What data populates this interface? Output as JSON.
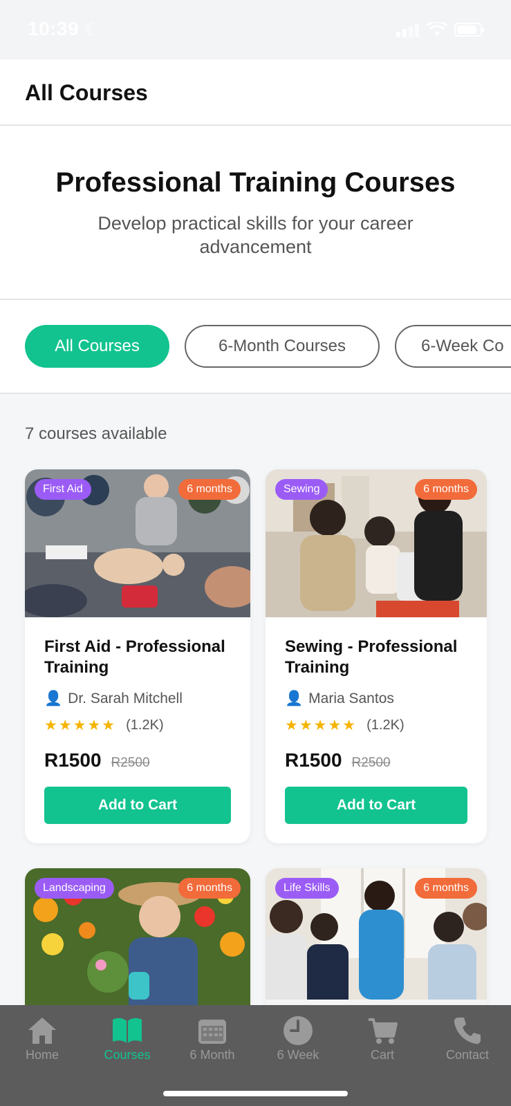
{
  "status": {
    "time": "10:39"
  },
  "header": {
    "title": "All Courses"
  },
  "hero": {
    "title": "Professional Training Courses",
    "subtitle": "Develop practical skills for your career advancement"
  },
  "filters": [
    {
      "label": "All Courses",
      "active": true
    },
    {
      "label": "6-Month Courses",
      "active": false
    },
    {
      "label": "6-Week Co",
      "active": false
    }
  ],
  "course_count": "7 courses available",
  "courses": [
    {
      "category": "First Aid",
      "duration": "6 months",
      "title": "First Aid - Professional Training",
      "instructor": "Dr. Sarah Mitchell",
      "stars": "★★★★★",
      "rating_count": "(1.2K)",
      "price": "R1500",
      "old_price": "R2500",
      "button": "Add to Cart"
    },
    {
      "category": "Sewing",
      "duration": "6 months",
      "title": "Sewing - Professional Training",
      "instructor": "Maria Santos",
      "stars": "★★★★★",
      "rating_count": "(1.2K)",
      "price": "R1500",
      "old_price": "R2500",
      "button": "Add to Cart"
    },
    {
      "category": "Landscaping",
      "duration": "6 months"
    },
    {
      "category": "Life Skills",
      "duration": "6 months"
    }
  ],
  "tabs": [
    {
      "label": "Home",
      "icon": "home-icon"
    },
    {
      "label": "Courses",
      "icon": "book-icon"
    },
    {
      "label": "6 Month",
      "icon": "calendar-icon"
    },
    {
      "label": "6 Week",
      "icon": "clock-icon"
    },
    {
      "label": "Cart",
      "icon": "cart-icon"
    },
    {
      "label": "Contact",
      "icon": "phone-icon"
    }
  ],
  "colors": {
    "accent": "#12c38f",
    "category_badge": "#9b5cf6",
    "duration_badge": "#f26b3a",
    "star": "#f5b400",
    "tabbar": "#5c5c5c"
  }
}
